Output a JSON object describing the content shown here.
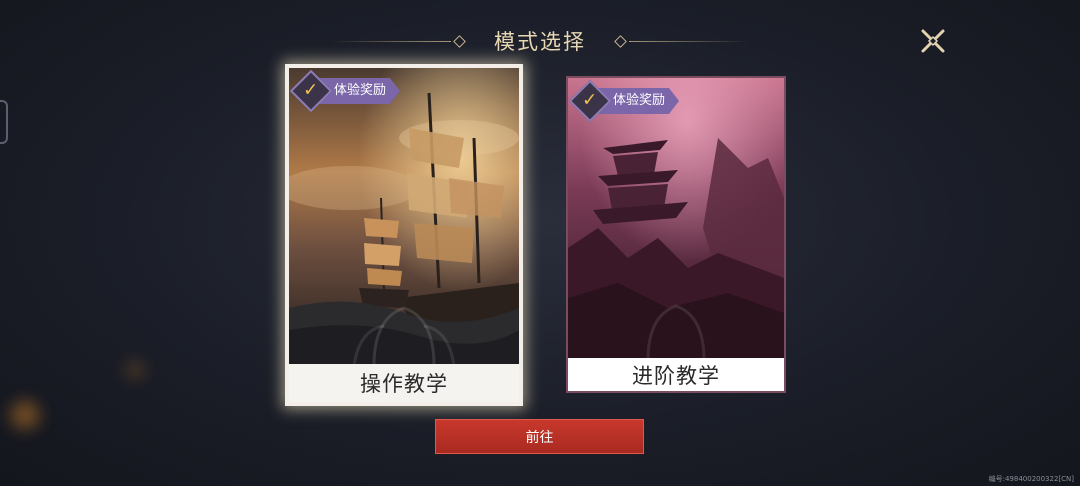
{
  "header": {
    "title": "模式选择"
  },
  "cards": [
    {
      "label": "操作教学",
      "badge": "体验奖励",
      "selected": true
    },
    {
      "label": "进阶教学",
      "badge": "体验奖励",
      "selected": false
    }
  ],
  "actions": {
    "go_label": "前往"
  },
  "footer": {
    "code": "编号:498400200322[CN]"
  },
  "colors": {
    "accent_gold": "#e8d8b4",
    "badge_purple": "#7a66a8",
    "button_red": "#b8302a"
  }
}
